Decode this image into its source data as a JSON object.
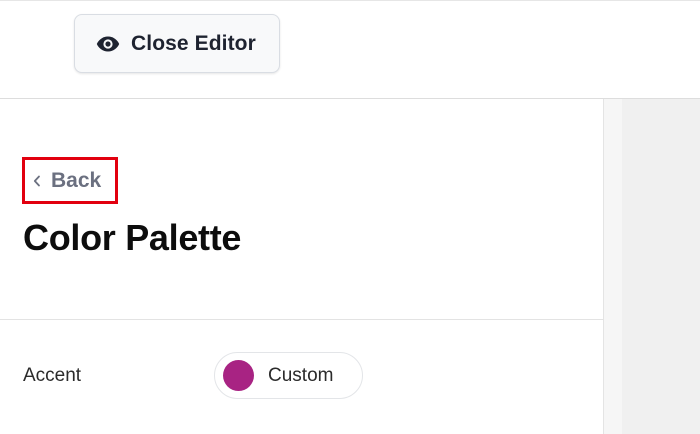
{
  "toolbar": {
    "close_editor_label": "Close Editor",
    "close_editor_icon": "eye-icon"
  },
  "panel": {
    "back_label": "Back",
    "back_icon": "chevron-left-icon",
    "title": "Color Palette",
    "rows": [
      {
        "label": "Accent",
        "value_label": "Custom",
        "swatch_color": "#a82383"
      }
    ]
  },
  "colors": {
    "highlight_border": "#e2000f",
    "back_text": "#6b7080",
    "accent_swatch": "#a82383"
  }
}
